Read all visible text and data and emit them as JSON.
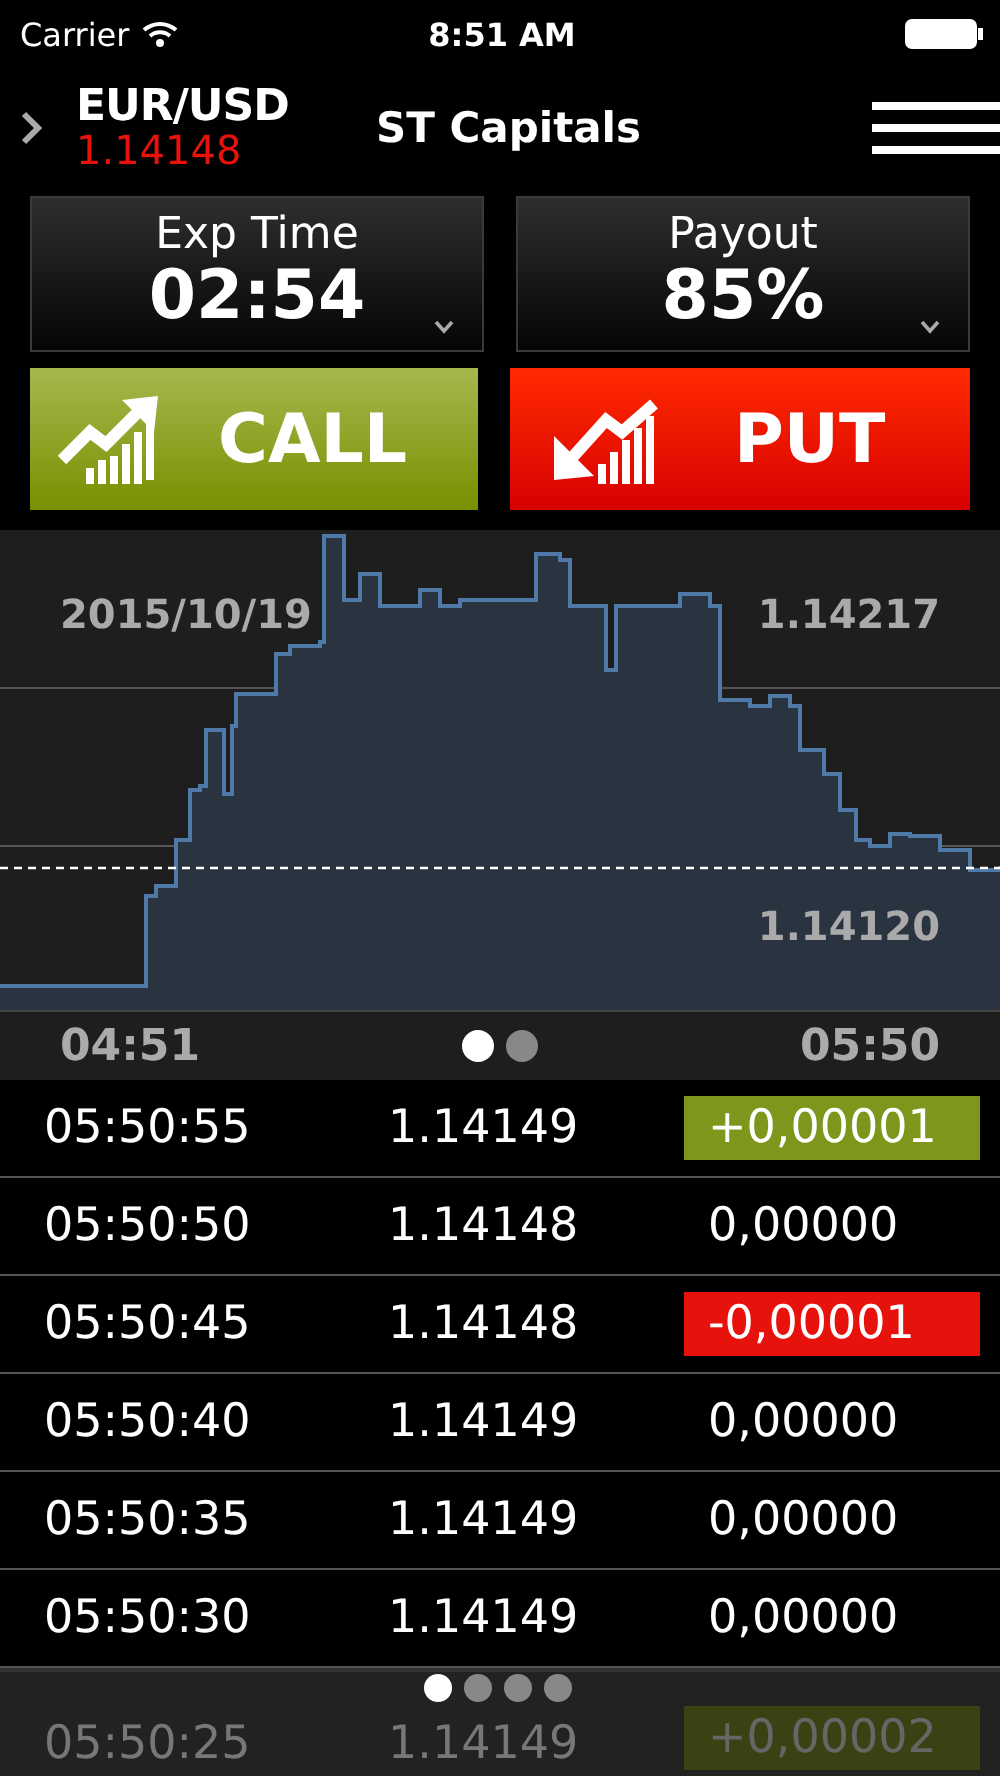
{
  "status_bar": {
    "carrier": "Carrier",
    "time": "8:51 AM"
  },
  "header": {
    "symbol": "EUR/USD",
    "price": "1.14148",
    "title": "ST Capitals"
  },
  "selectors": [
    {
      "label": "Exp Time",
      "value": "02:54"
    },
    {
      "label": "Payout",
      "value": "85%"
    }
  ],
  "trade_buttons": [
    {
      "kind": "call",
      "label": "CALL"
    },
    {
      "kind": "put",
      "label": "PUT"
    }
  ],
  "chart": {
    "date": "2015/10/19",
    "upper_price": "1.14217",
    "lower_price": "1.14120",
    "time_start": "04:51",
    "time_end": "05:50",
    "pages": [
      {
        "selected": true
      },
      {
        "selected": false
      }
    ]
  },
  "ticks": [
    {
      "time": "05:50:55",
      "price": "1.14149",
      "change": "+0,00001",
      "kind": "up",
      "faded": false
    },
    {
      "time": "05:50:50",
      "price": "1.14148",
      "change": "0,00000",
      "kind": "flat",
      "faded": false
    },
    {
      "time": "05:50:45",
      "price": "1.14148",
      "change": "-0,00001",
      "kind": "down",
      "faded": false
    },
    {
      "time": "05:50:40",
      "price": "1.14149",
      "change": "0,00000",
      "kind": "flat",
      "faded": false
    },
    {
      "time": "05:50:35",
      "price": "1.14149",
      "change": "0,00000",
      "kind": "flat",
      "faded": false
    },
    {
      "time": "05:50:30",
      "price": "1.14149",
      "change": "0,00000",
      "kind": "flat",
      "faded": false
    },
    {
      "time": "05:50:25",
      "price": "1.14149",
      "change": "+0,00002",
      "kind": "up",
      "faded": true
    }
  ],
  "list_pages": [
    {
      "selected": true
    },
    {
      "selected": false
    },
    {
      "selected": false
    },
    {
      "selected": false
    }
  ]
}
